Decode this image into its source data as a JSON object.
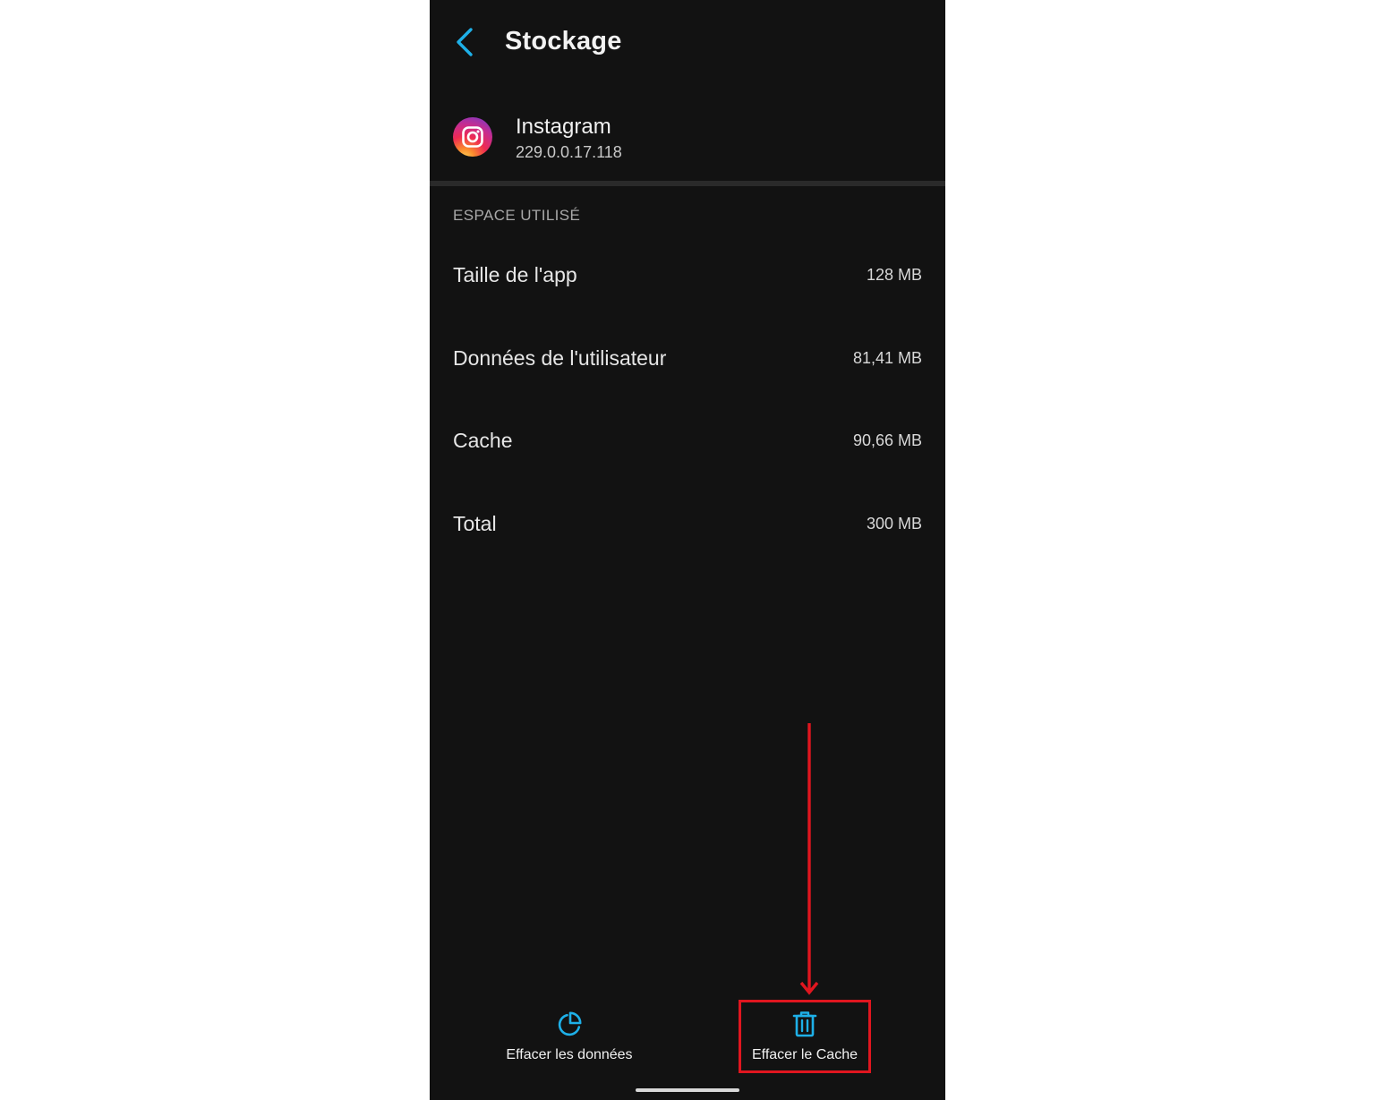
{
  "header": {
    "title": "Stockage",
    "back_icon": "chevron-left-icon",
    "accent_color": "#1eb0e8"
  },
  "app": {
    "name": "Instagram",
    "version": "229.0.0.17.118",
    "icon": "instagram-logo"
  },
  "storage": {
    "section_label": "ESPACE UTILISÉ",
    "rows": [
      {
        "label": "Taille de l'app",
        "value": "128 MB"
      },
      {
        "label": "Données de l'utilisateur",
        "value": "81,41 MB"
      },
      {
        "label": "Cache",
        "value": "90,66 MB"
      },
      {
        "label": "Total",
        "value": "300 MB"
      }
    ]
  },
  "actions": {
    "clear_data": {
      "label": "Effacer les données",
      "icon": "pie-chart-icon"
    },
    "clear_cache": {
      "label": "Effacer le Cache",
      "icon": "trash-icon"
    }
  },
  "annotation": {
    "color": "#e0161f",
    "target": "clear_cache"
  }
}
